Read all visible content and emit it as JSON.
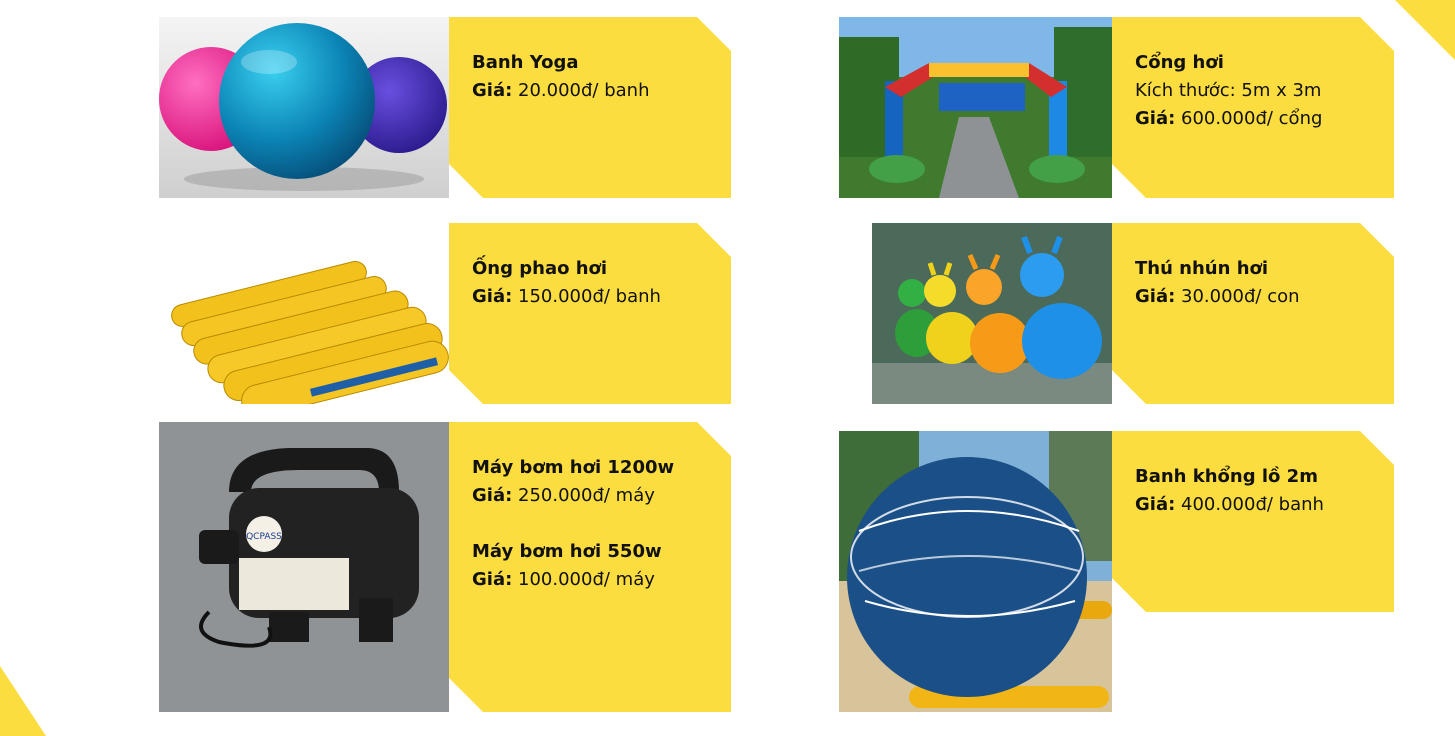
{
  "accent_color": "#FCDD3F",
  "products": [
    {
      "id": "yoga-ball",
      "image": "yoga-balls-photo",
      "title": "Banh Yoga",
      "price_label": "Giá:",
      "price": " 20.000đ/ banh"
    },
    {
      "id": "inflatable-gate",
      "image": "inflatable-arch-gate-photo",
      "title": "Cổng hơi",
      "size": "Kích thước: 5m x 3m",
      "price_label": "Giá:",
      "price": " 600.000đ/ cổng"
    },
    {
      "id": "float-tube",
      "image": "inflatable-float-tubes-photo",
      "title": "Ống phao hơi",
      "price_label": "Giá:",
      "price": " 150.000đ/ banh"
    },
    {
      "id": "bouncy-animal",
      "image": "inflatable-deer-toys-photo",
      "title": "Thú nhún hơi",
      "price_label": "Giá:",
      "price": " 30.000đ/ con"
    },
    {
      "id": "air-pump",
      "image": "electric-air-pump-photo",
      "title": "Máy bơm hơi 1200w",
      "price_label": "Giá:",
      "price": " 250.000đ/ máy",
      "title2": "Máy bơm hơi 550w",
      "price2": " 100.000đ/ máy",
      "pump_label": "QCPASS"
    },
    {
      "id": "giant-ball",
      "image": "giant-ball-photo",
      "title": "Banh khổng lồ 2m",
      "price_label": "Giá:",
      "price": " 400.000đ/ banh"
    }
  ]
}
